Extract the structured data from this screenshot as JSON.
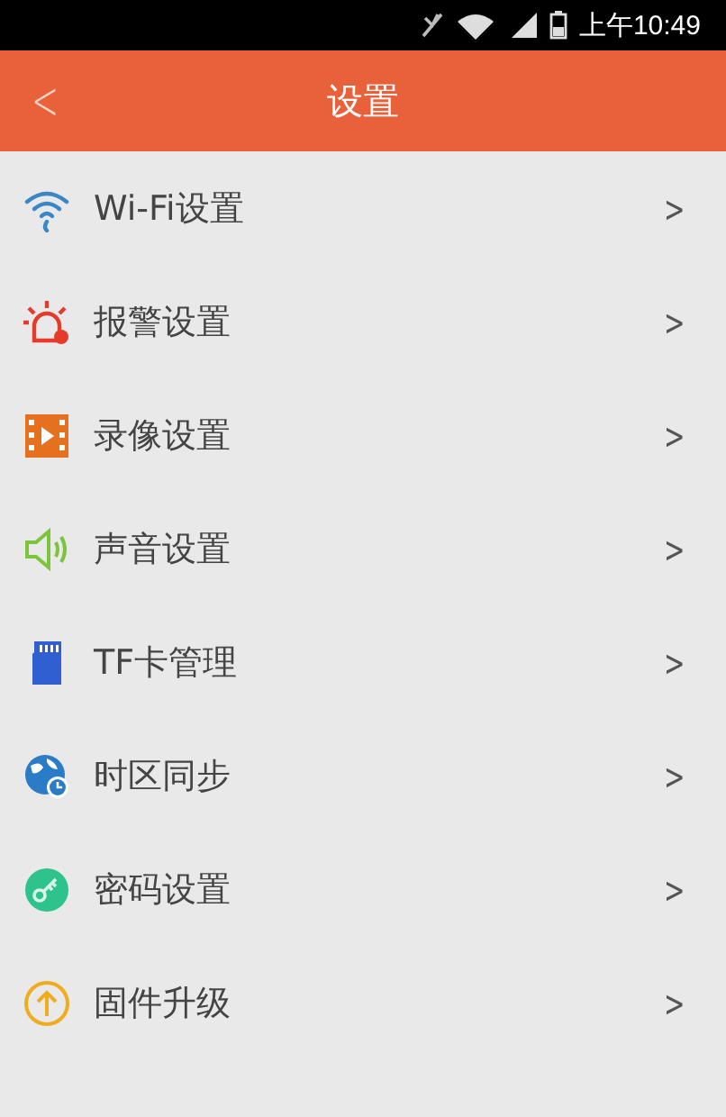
{
  "status_bar": {
    "time": "上午10:49"
  },
  "header": {
    "back": "<",
    "title": "设置"
  },
  "items": [
    {
      "kind": "wifi",
      "label": "Wi-Fi设置",
      "arrow": ">"
    },
    {
      "kind": "alarm",
      "label": "报警设置",
      "arrow": ">"
    },
    {
      "kind": "video",
      "label": "录像设置",
      "arrow": ">"
    },
    {
      "kind": "sound",
      "label": "声音设置",
      "arrow": ">"
    },
    {
      "kind": "sdcard",
      "label": "TF卡管理",
      "arrow": ">"
    },
    {
      "kind": "globe",
      "label": "时区同步",
      "arrow": ">"
    },
    {
      "kind": "key",
      "label": "密码设置",
      "arrow": ">"
    },
    {
      "kind": "upgrade",
      "label": "固件升级",
      "arrow": ">"
    }
  ]
}
